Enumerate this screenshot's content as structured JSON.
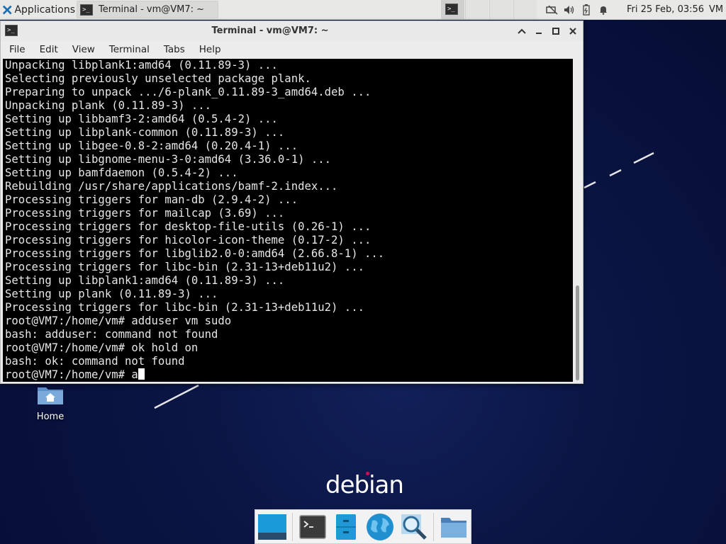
{
  "top_panel": {
    "applications_label": "Applications",
    "task_label": "Terminal - vm@VM7: ~",
    "clock": "Fri 25 Feb, 03:56",
    "user": "VM"
  },
  "window": {
    "title": "Terminal - vm@VM7: ~",
    "menu": [
      "File",
      "Edit",
      "View",
      "Terminal",
      "Tabs",
      "Help"
    ]
  },
  "terminal": {
    "lines": [
      "Unpacking libplank1:amd64 (0.11.89-3) ...",
      "Selecting previously unselected package plank.",
      "Preparing to unpack .../6-plank_0.11.89-3_amd64.deb ...",
      "Unpacking plank (0.11.89-3) ...",
      "Setting up libbamf3-2:amd64 (0.5.4-2) ...",
      "Setting up libplank-common (0.11.89-3) ...",
      "Setting up libgee-0.8-2:amd64 (0.20.4-1) ...",
      "Setting up libgnome-menu-3-0:amd64 (3.36.0-1) ...",
      "Setting up bamfdaemon (0.5.4-2) ...",
      "Rebuilding /usr/share/applications/bamf-2.index...",
      "Processing triggers for man-db (2.9.4-2) ...",
      "Processing triggers for mailcap (3.69) ...",
      "Processing triggers for desktop-file-utils (0.26-1) ...",
      "Processing triggers for hicolor-icon-theme (0.17-2) ...",
      "Processing triggers for libglib2.0-0:amd64 (2.66.8-1) ...",
      "Processing triggers for libc-bin (2.31-13+deb11u2) ...",
      "Setting up libplank1:amd64 (0.11.89-3) ...",
      "Setting up plank (0.11.89-3) ...",
      "Processing triggers for libc-bin (2.31-13+deb11u2) ...",
      "root@VM7:/home/vm# adduser vm sudo",
      "bash: adduser: command not found",
      "root@VM7:/home/vm# ok hold on",
      "bash: ok: command not found"
    ],
    "prompt": "root@VM7:/home/vm# ",
    "input": "a"
  },
  "desktop": {
    "home_label": "Home",
    "logo_text": "debian"
  },
  "dock": {
    "items": [
      "show-desktop",
      "terminal",
      "file-cabinet",
      "web-browser",
      "app-finder",
      "file-manager"
    ]
  },
  "colors": {
    "desktop_bg": "#07103a",
    "terminal_bg": "#000000",
    "terminal_fg": "#e6e6e6",
    "debian_red": "#d70a53"
  }
}
